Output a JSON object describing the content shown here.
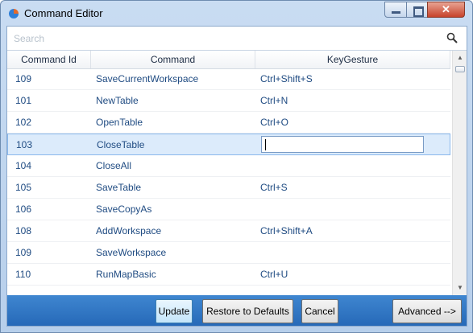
{
  "window": {
    "title": "Command Editor"
  },
  "search": {
    "placeholder": "Search"
  },
  "grid": {
    "columns": [
      "Command Id",
      "Command",
      "KeyGesture"
    ],
    "rows": [
      {
        "id": "109",
        "command": "SaveCurrentWorkspace",
        "key": "Ctrl+Shift+S"
      },
      {
        "id": "101",
        "command": "NewTable",
        "key": "Ctrl+N"
      },
      {
        "id": "102",
        "command": "OpenTable",
        "key": "Ctrl+O"
      },
      {
        "id": "103",
        "command": "CloseTable",
        "key": ""
      },
      {
        "id": "104",
        "command": "CloseAll",
        "key": ""
      },
      {
        "id": "105",
        "command": "SaveTable",
        "key": "Ctrl+S"
      },
      {
        "id": "106",
        "command": "SaveCopyAs",
        "key": ""
      },
      {
        "id": "108",
        "command": "AddWorkspace",
        "key": "Ctrl+Shift+A"
      },
      {
        "id": "109",
        "command": "SaveWorkspace",
        "key": ""
      },
      {
        "id": "110",
        "command": "RunMapBasic",
        "key": "Ctrl+U"
      }
    ],
    "selected_row_index": 3
  },
  "buttons": {
    "update": "Update",
    "restore": "Restore to Defaults",
    "cancel": "Cancel",
    "advanced": "Advanced -->"
  },
  "colors": {
    "accent": "#2f78c6",
    "selected_row": "#dcebfb",
    "text_link": "#1f4b82"
  }
}
